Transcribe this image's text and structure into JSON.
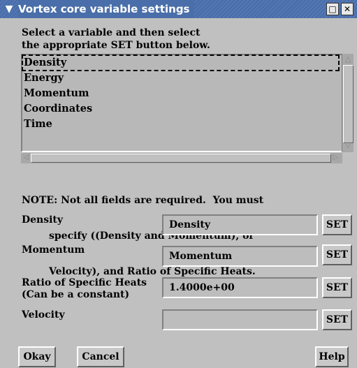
{
  "window": {
    "title": "Vortex core variable settings",
    "menu_icon": "chevron-down-icon",
    "maximize_icon": "maximize-icon",
    "close_icon": "close-icon",
    "maximize_glyph": "□",
    "close_glyph": "✕",
    "menu_glyph": "▼"
  },
  "prompt": {
    "line1": "Select a variable and then select",
    "line2": "the appropriate SET button below."
  },
  "variables": {
    "items": [
      "Density",
      "Energy",
      "Momentum",
      "Coordinates",
      "Time"
    ],
    "selected_index": 0
  },
  "scroll": {
    "up": "△",
    "down": "▽",
    "left": "◁",
    "right": "▷"
  },
  "note": {
    "line1": "NOTE: Not all fields are required.  You must",
    "line2": "        specify ((Density and Momentum), or",
    "line3": "        Velocity), and Ratio of Specific Heats."
  },
  "fields": [
    {
      "label": "Density",
      "value": "Density",
      "button": "SET"
    },
    {
      "label": "Momentum",
      "value": "Momentum",
      "button": "SET"
    },
    {
      "label": "Ratio of Specific Heats\n(Can be a constant)",
      "value": "1.4000e+00",
      "button": "SET"
    },
    {
      "label": "Velocity",
      "value": "",
      "button": "SET"
    }
  ],
  "footer": {
    "okay": "Okay",
    "cancel": "Cancel",
    "help": "Help"
  },
  "colors": {
    "titlebar": "#4a6ea9",
    "window": "#c0c0c0",
    "desktop": "#3b6ea5"
  }
}
